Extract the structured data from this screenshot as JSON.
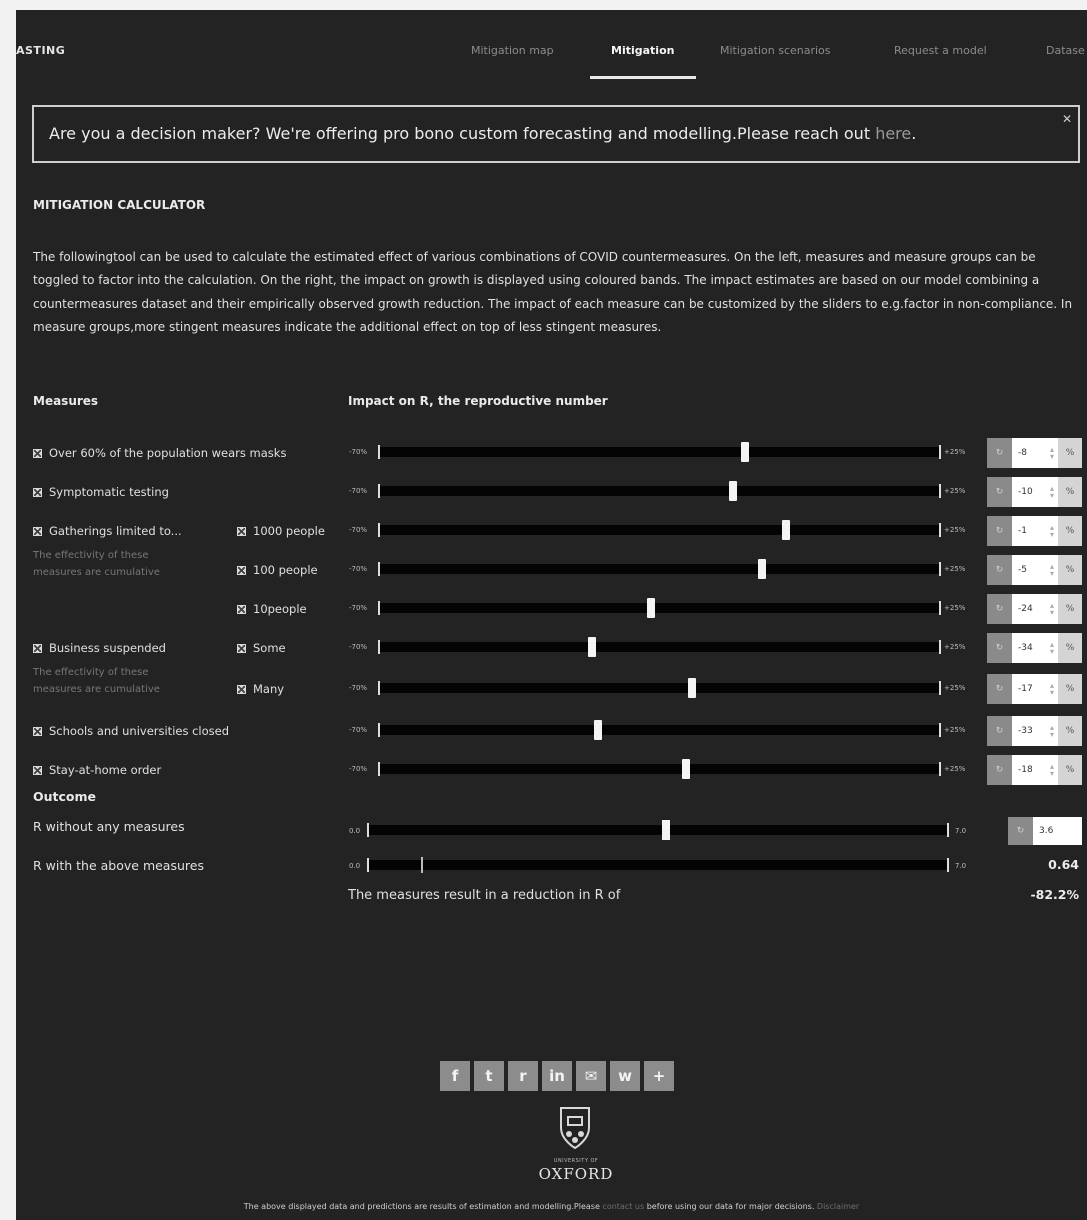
{
  "nav": {
    "brand": "ASTING",
    "tabs": [
      "Mitigation map",
      "Mitigation",
      "Mitigation scenarios",
      "Request a model",
      "Datase"
    ],
    "active": "Mitigation"
  },
  "banner": {
    "text": "Are you a decision maker? We're offering pro bono custom forecasting and modelling.Please reach out ",
    "link": "here",
    "tail": ".",
    "close": "✕"
  },
  "calculator": {
    "title": "MITIGATION CALCULATOR",
    "intro": "The followingtool can be used to calculate the estimated effect of various combinations of COVID countermeasures. On the left, measures and measure groups can be toggled to factor into the calculation. On the right, the impact on growth is displayed using coloured bands. The impact estimates are based on our model combining a countermeasures dataset and their empirically observed growth reduction. The impact of each measure can be customized by the sliders to e.g.factor in non-compliance. In measure groups,more stingent measures indicate the additional effect on top of less stingent measures.",
    "col_measures": "Measures",
    "col_impact": "Impact on R, the reproductive number",
    "range_min": "-70%",
    "range_max": "+25%",
    "group_note_a": "The effectivity of these measures are cumulative",
    "group_note_b": "The effectivity of these measures are cumulative",
    "rows": [
      {
        "label": "Over 60% of the population wears masks",
        "sub": "",
        "value": "-8",
        "unit": "%",
        "btn": "↻"
      },
      {
        "label": "Symptomatic testing",
        "sub": "",
        "value": "-10",
        "unit": "%",
        "btn": "↻"
      },
      {
        "label": "Gatherings limited to...",
        "sub": "1000 people",
        "value": "-1",
        "unit": "%",
        "btn": "↻"
      },
      {
        "label": "",
        "sub": "100 people",
        "value": "-5",
        "unit": "%",
        "btn": "↻"
      },
      {
        "label": "",
        "sub": "10people",
        "value": "-24",
        "unit": "%",
        "btn": "↻"
      },
      {
        "label": "Business suspended",
        "sub": "Some",
        "value": "-34",
        "unit": "%",
        "btn": "↻"
      },
      {
        "label": "",
        "sub": "Many",
        "value": "-17",
        "unit": "%",
        "btn": "↻"
      },
      {
        "label": "Schools and universities closed",
        "sub": "",
        "value": "-33",
        "unit": "%",
        "btn": "↻"
      },
      {
        "label": "Stay-at-home order",
        "sub": "",
        "value": "-18",
        "unit": "%",
        "btn": "↻"
      }
    ]
  },
  "outcome": {
    "title": "Outcome",
    "r_without_label": "R without any measures",
    "r_without_value": "3.6",
    "r_with_label": "R with the above measures",
    "r_with_value": "0.64",
    "r_min": "0.0",
    "r_max": "7.0",
    "reduction_label": "The measures result in a reduction in R of",
    "reduction_value": "-82.2%",
    "btn": "↻"
  },
  "share": {
    "buttons": [
      "f",
      "t",
      "r",
      "in",
      "✉",
      "w",
      "+"
    ],
    "icons": [
      "facebook-icon",
      "twitter-icon",
      "reddit-icon",
      "linkedin-icon",
      "email-icon",
      "whatsapp-icon",
      "plus-icon"
    ]
  },
  "university": {
    "small": "UNIVERSITY OF",
    "name": "OXFORD"
  },
  "footer": {
    "text": "The above displayed data and predictions are results of estimation and modelling.Please ",
    "contact": "contact us",
    "text2": " before using our data for major decisions. ",
    "disclaimer": "Disclaimer"
  }
}
